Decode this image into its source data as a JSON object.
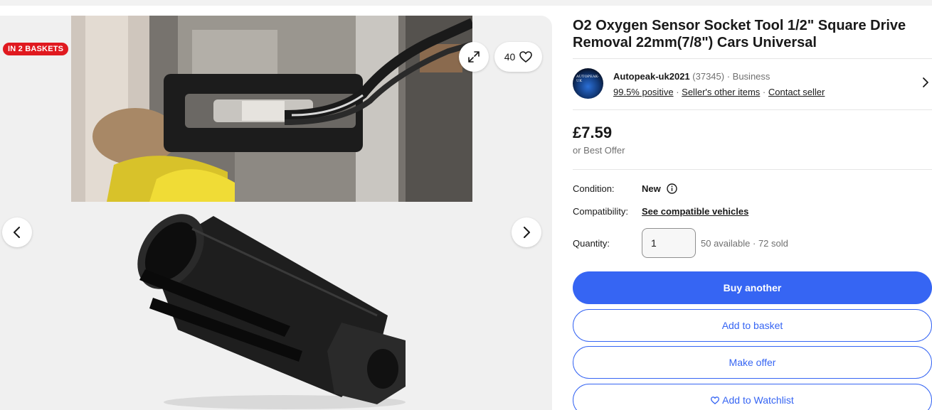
{
  "gallery": {
    "badge": "IN 2 BASKETS",
    "watch_count": "40",
    "icons": {
      "expand": "expand-icon",
      "heart": "heart-icon",
      "prev": "chevron-left-icon",
      "next": "chevron-right-icon"
    }
  },
  "listing": {
    "title": "O2 Oxygen Sensor Socket Tool 1/2\" Square Drive Removal 22mm(7/8\") Cars Universal"
  },
  "seller": {
    "name": "Autopeak-uk2021",
    "feedback_count": "(37345)",
    "type": "· Business",
    "positive": "99.5% positive",
    "other_items": "Seller's other items",
    "contact": "Contact seller",
    "avatar_text": "AUTOPEAK-UK"
  },
  "price": {
    "amount": "£7.59",
    "best_offer": "or Best Offer"
  },
  "specs": {
    "condition_label": "Condition:",
    "condition_value": "New",
    "compatibility_label": "Compatibility:",
    "compatibility_link": "See compatible vehicles",
    "quantity_label": "Quantity:",
    "quantity_value": "1",
    "availability": "50 available · 72 sold"
  },
  "actions": {
    "buy": "Buy another",
    "basket": "Add to basket",
    "offer": "Make offer",
    "watchlist": "Add to Watchlist"
  },
  "colors": {
    "primary": "#3665f3",
    "badge": "#e0191f",
    "muted_text": "#707070"
  }
}
